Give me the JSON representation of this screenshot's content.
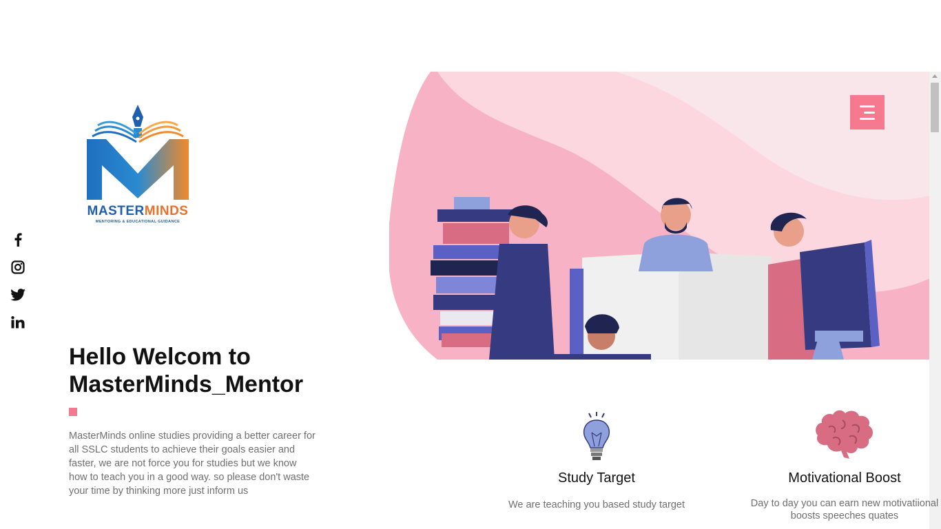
{
  "brand": {
    "name_part1": "MASTER",
    "name_part2": "MINDS",
    "tagline": "MENTORING & EDUCATIONAL GUIDANCE"
  },
  "social": [
    {
      "icon": "facebook-icon",
      "glyph": "f"
    },
    {
      "icon": "instagram-icon"
    },
    {
      "icon": "twitter-icon"
    },
    {
      "icon": "linkedin-icon",
      "glyph": "in"
    }
  ],
  "hero": {
    "title": "Hello Welcom to MasterMinds_Mentor",
    "description": "MasterMinds online studies providing a better career for all SSLC students to achieve their goals easier and faster, we are not force you for studies but we know how to teach you in a good way. so please don't waste your time by thinking more just inform us"
  },
  "header": {
    "menu_icon": "hamburger-menu-icon"
  },
  "features": [
    {
      "icon": "lightbulb-icon",
      "title": "Study Target",
      "description": "We are teaching you based study target"
    },
    {
      "icon": "brain-icon",
      "title": "Motivational Boost",
      "description": "Day to day you can earn new motivatiional boosts speeches quates"
    }
  ],
  "colors": {
    "accent": "#f57a90",
    "pink_light": "#fcd7e0",
    "pink_mid": "#f7b3c5",
    "navy": "#363a80",
    "blue_logo": "#1f5fad",
    "orange_logo": "#e8722a"
  }
}
